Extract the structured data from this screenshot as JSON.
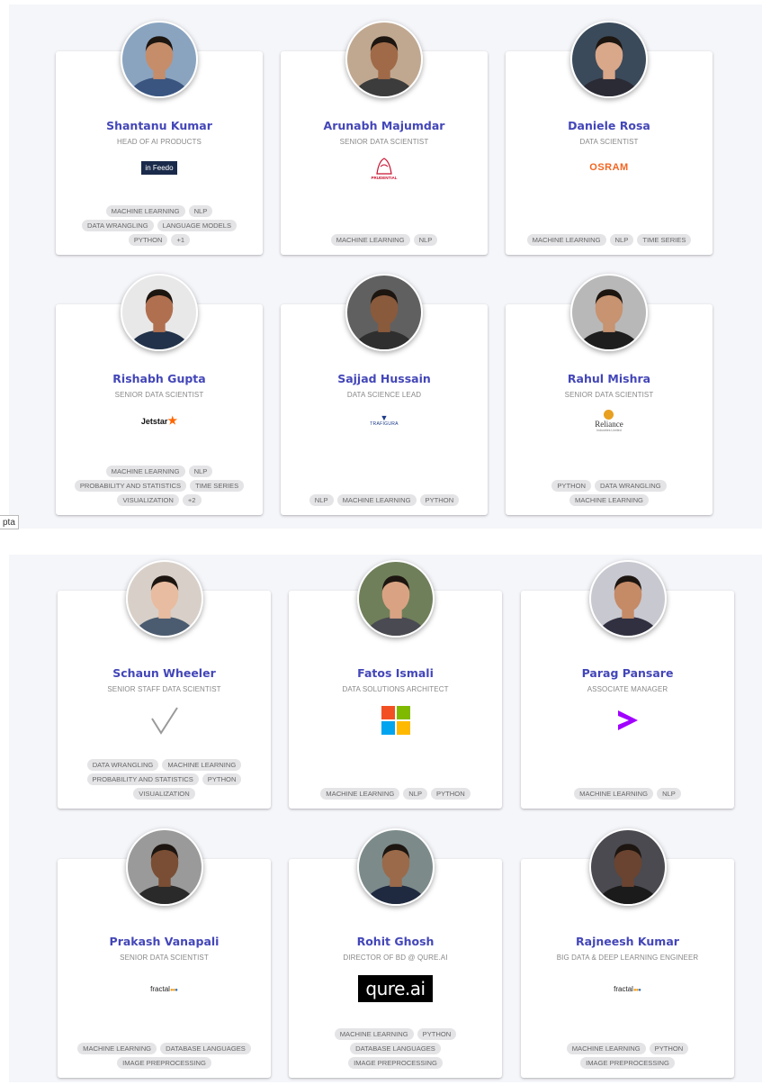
{
  "tooltip": "pta",
  "experts": [
    {
      "name": "Shantanu Kumar",
      "role": "HEAD OF AI PRODUCTS",
      "company": "inFeedo",
      "logo_text": "in Feedo",
      "tags": [
        "MACHINE LEARNING",
        "NLP",
        "DATA WRANGLING",
        "LANGUAGE MODELS",
        "PYTHON",
        "+1"
      ]
    },
    {
      "name": "Arunabh Majumdar",
      "role": "SENIOR DATA SCIENTIST",
      "company": "Prudential",
      "logo_text": "PRUDENTIAL",
      "tags": [
        "MACHINE LEARNING",
        "NLP"
      ]
    },
    {
      "name": "Daniele Rosa",
      "role": "DATA SCIENTIST",
      "company": "OSRAM",
      "logo_text": "OSRAM",
      "tags": [
        "MACHINE LEARNING",
        "NLP",
        "TIME SERIES"
      ]
    },
    {
      "name": "Rishabh Gupta",
      "role": "SENIOR DATA SCIENTIST",
      "company": "Jetstar",
      "logo_text": "Jetstar",
      "tags": [
        "MACHINE LEARNING",
        "NLP",
        "PROBABILITY AND STATISTICS",
        "TIME SERIES",
        "VISUALIZATION",
        "+2"
      ]
    },
    {
      "name": "Sajjad Hussain",
      "role": "DATA SCIENCE LEAD",
      "company": "Trafigura",
      "logo_text": "TRAFIGURA",
      "tags": [
        "NLP",
        "MACHINE LEARNING",
        "PYTHON"
      ]
    },
    {
      "name": "Rahul Mishra",
      "role": "SENIOR DATA SCIENTIST",
      "company": "Reliance",
      "logo_text": "Reliance",
      "logo_sub": "Industries Limited",
      "tags": [
        "PYTHON",
        "DATA WRANGLING",
        "MACHINE LEARNING"
      ]
    },
    {
      "name": "Schaun Wheeler",
      "role": "SENIOR STAFF DATA SCIENTIST",
      "company": "Valassis",
      "logo_text": "",
      "tags": [
        "DATA WRANGLING",
        "MACHINE LEARNING",
        "PROBABILITY AND STATISTICS",
        "PYTHON",
        "VISUALIZATION"
      ]
    },
    {
      "name": "Fatos Ismali",
      "role": "DATA SOLUTIONS ARCHITECT",
      "company": "Microsoft",
      "logo_text": "",
      "tags": [
        "MACHINE LEARNING",
        "NLP",
        "PYTHON"
      ]
    },
    {
      "name": "Parag Pansare",
      "role": "ASSOCIATE MANAGER",
      "company": "Accenture",
      "logo_text": "",
      "tags": [
        "MACHINE LEARNING",
        "NLP"
      ]
    },
    {
      "name": "Prakash Vanapali",
      "role": "SENIOR DATA SCIENTIST",
      "company": "Fractal",
      "logo_text": "fractal",
      "tags": [
        "MACHINE LEARNING",
        "DATABASE LANGUAGES",
        "IMAGE PREPROCESSING"
      ]
    },
    {
      "name": "Rohit Ghosh",
      "role": "DIRECTOR OF BD @ QURE.AI",
      "company": "Qure.ai",
      "logo_text": "qure.ai",
      "tags": [
        "MACHINE LEARNING",
        "PYTHON",
        "DATABASE LANGUAGES",
        "IMAGE PREPROCESSING"
      ]
    },
    {
      "name": "Rajneesh Kumar",
      "role": "BIG DATA & DEEP LEARNING ENGINEER",
      "company": "Fractal",
      "logo_text": "fractal",
      "tags": [
        "MACHINE LEARNING",
        "PYTHON",
        "IMAGE PREPROCESSING"
      ]
    }
  ],
  "colors": {
    "name": "#4346b8",
    "role": "#888888",
    "tag_bg": "#e4e4e7",
    "panel_bg": "#f5f6fa",
    "skin_tones": [
      "#c58d6a",
      "#a06a48",
      "#d9a78a",
      "#b07050",
      "#8a5a3c",
      "#c79370",
      "#e8bca0",
      "#d9a383",
      "#c58a66",
      "#7a4e34",
      "#9a6a4a",
      "#6a4430"
    ]
  }
}
